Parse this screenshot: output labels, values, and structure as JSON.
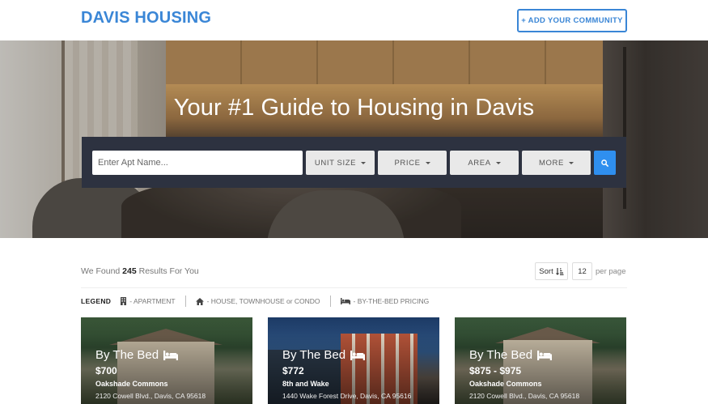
{
  "header": {
    "brand": "DAVIS HOUSING",
    "add_button": "+ ADD YOUR COMMUNITY"
  },
  "hero": {
    "title": "Your #1 Guide to Housing in Davis",
    "search": {
      "placeholder": "Enter Apt Name...",
      "filters": [
        "UNIT SIZE",
        "PRICE",
        "AREA",
        "MORE"
      ],
      "search_icon": "search-icon"
    }
  },
  "results": {
    "prefix": "We Found",
    "count": "245",
    "suffix": "Results For You",
    "sort_label": "Sort",
    "sort_icon": "sort-amount-icon",
    "per_page_value": "12",
    "per_page_label": "per page"
  },
  "legend": {
    "title": "LEGEND",
    "items": [
      {
        "icon": "building-icon",
        "label": "- APARTMENT"
      },
      {
        "icon": "home-icon",
        "label": "- HOUSE, TOWNHOUSE or CONDO"
      },
      {
        "icon": "bed-icon",
        "label": "- BY-THE-BED PRICING"
      }
    ]
  },
  "cards": [
    {
      "type": "By The Bed",
      "icon": "bed-icon",
      "price": "$700",
      "name": "Oakshade Commons",
      "address": "2120 Cowell Blvd., Davis, CA 95618"
    },
    {
      "type": "By The Bed",
      "icon": "bed-icon",
      "price": "$772",
      "name": "8th and Wake",
      "address": "1440 Wake Forest Drive, Davis, CA 95616"
    },
    {
      "type": "By The Bed",
      "icon": "bed-icon",
      "price": "$875 - $975",
      "name": "Oakshade Commons",
      "address": "2120 Cowell Blvd., Davis, CA 95618"
    }
  ],
  "colors": {
    "brand": "#3a86d6",
    "search_panel": "#2d3240",
    "search_button": "#2f8fef"
  }
}
